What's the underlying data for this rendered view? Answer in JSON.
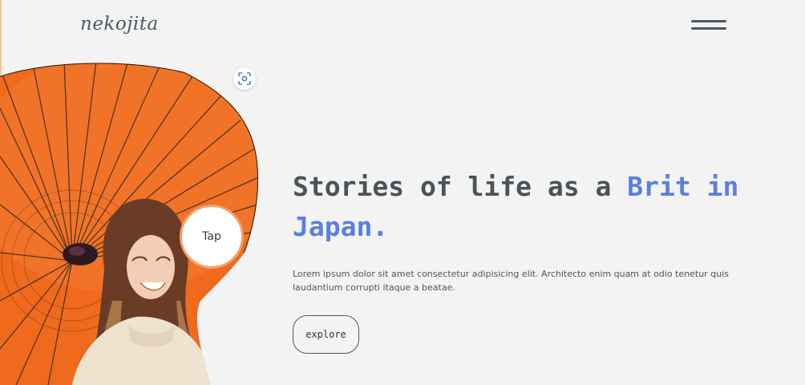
{
  "header": {
    "logo_text": "nekojita",
    "menu_icon": "hamburger-icon"
  },
  "hero": {
    "image_description_icon": "umbrella-photo",
    "focus_icon": "focus-scan-icon",
    "tap_label": "Tap",
    "headline_part1": "Stories of life as a ",
    "headline_accent": "Brit in Japan.",
    "description": "Lorem ipsum dolor sit amet consectetur adipisicing elit. Architecto enim quam at odio tenetur quis laudantium corrupti itaque a beatae.",
    "cta_label": "explore"
  },
  "colors": {
    "background": "#f3f3f3",
    "accent": "#5b7fe0",
    "text_dark": "#4a5459",
    "umbrella": "#ef6a1c",
    "tap_ring": "#f4a06a"
  }
}
